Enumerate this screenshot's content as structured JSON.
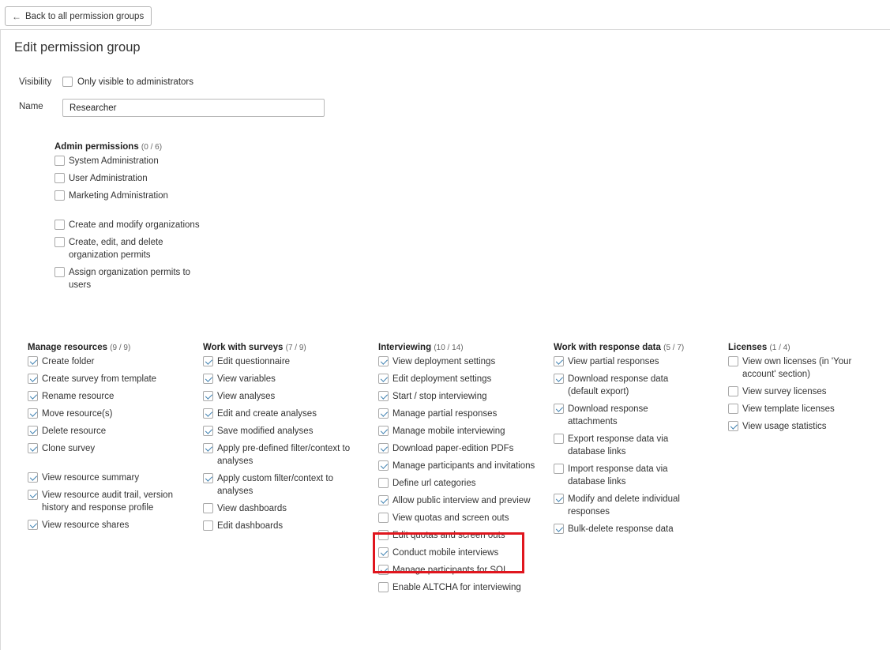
{
  "topbar": {
    "back_label": "Back to all permission groups"
  },
  "page_title": "Edit permission group",
  "visibility": {
    "label": "Visibility",
    "checkbox_label": "Only visible to administrators",
    "checked": false
  },
  "name_field": {
    "label": "Name",
    "value": "Researcher"
  },
  "admin": {
    "title": "Admin permissions",
    "count": "(0 / 6)",
    "items": [
      {
        "label": "System Administration",
        "checked": false
      },
      {
        "label": "User Administration",
        "checked": false
      },
      {
        "label": "Marketing Administration",
        "checked": false
      },
      {
        "label": "Create and modify organizations",
        "checked": false
      },
      {
        "label": "Create, edit, and delete organization permits",
        "checked": false
      },
      {
        "label": "Assign organization permits to users",
        "checked": false
      }
    ]
  },
  "columns": [
    {
      "title": "Manage resources",
      "count": "(9 / 9)",
      "items": [
        {
          "label": "Create folder",
          "checked": true
        },
        {
          "label": "Create survey from template",
          "checked": true
        },
        {
          "label": "Rename resource",
          "checked": true
        },
        {
          "label": "Move resource(s)",
          "checked": true
        },
        {
          "label": "Delete resource",
          "checked": true
        },
        {
          "label": "Clone survey",
          "checked": true
        },
        {
          "label": "View resource summary",
          "checked": true
        },
        {
          "label": "View resource audit trail, version history and response profile",
          "checked": true
        },
        {
          "label": "View resource shares",
          "checked": true
        }
      ]
    },
    {
      "title": "Work with surveys",
      "count": "(7 / 9)",
      "items": [
        {
          "label": "Edit questionnaire",
          "checked": true
        },
        {
          "label": "View variables",
          "checked": true
        },
        {
          "label": "View analyses",
          "checked": true
        },
        {
          "label": "Edit and create analyses",
          "checked": true
        },
        {
          "label": "Save modified analyses",
          "checked": true
        },
        {
          "label": "Apply pre-defined filter/context to analyses",
          "checked": true
        },
        {
          "label": "Apply custom filter/context to analyses",
          "checked": true
        },
        {
          "label": "View dashboards",
          "checked": false
        },
        {
          "label": "Edit dashboards",
          "checked": false
        }
      ]
    },
    {
      "title": "Interviewing",
      "count": "(10 / 14)",
      "items": [
        {
          "label": "View deployment settings",
          "checked": true
        },
        {
          "label": "Edit deployment settings",
          "checked": true
        },
        {
          "label": "Start / stop interviewing",
          "checked": true
        },
        {
          "label": "Manage partial responses",
          "checked": true
        },
        {
          "label": "Manage mobile interviewing",
          "checked": true
        },
        {
          "label": "Download paper-edition PDFs",
          "checked": true
        },
        {
          "label": "Manage participants and invitations",
          "checked": true
        },
        {
          "label": "Define url categories",
          "checked": false
        },
        {
          "label": "Allow public interview and preview",
          "checked": true
        },
        {
          "label": "View quotas and screen outs",
          "checked": false
        },
        {
          "label": "Edit quotas and screen outs",
          "checked": false
        },
        {
          "label": "Conduct mobile interviews",
          "checked": true
        },
        {
          "label": "Manage participants for SOI",
          "checked": true
        },
        {
          "label": "Enable ALTCHA for interviewing",
          "checked": false
        }
      ]
    },
    {
      "title": "Work with response data",
      "count": "(5 / 7)",
      "items": [
        {
          "label": "View partial responses",
          "checked": true
        },
        {
          "label": "Download response data (default export)",
          "checked": true
        },
        {
          "label": "Download response attachments",
          "checked": true
        },
        {
          "label": "Export response data via database links",
          "checked": false
        },
        {
          "label": "Import response data via database links",
          "checked": false
        },
        {
          "label": "Modify and delete individual responses",
          "checked": true
        },
        {
          "label": "Bulk-delete response data",
          "checked": true
        }
      ]
    },
    {
      "title": "Licenses",
      "count": "(1 / 4)",
      "items": [
        {
          "label": "View own licenses (in 'Your account' section)",
          "checked": false
        },
        {
          "label": "View survey licenses",
          "checked": false
        },
        {
          "label": "View template licenses",
          "checked": false
        },
        {
          "label": "View usage statistics",
          "checked": true
        }
      ]
    }
  ],
  "colors": {
    "highlight": "#e0161e",
    "check": "#3c7fb0"
  }
}
